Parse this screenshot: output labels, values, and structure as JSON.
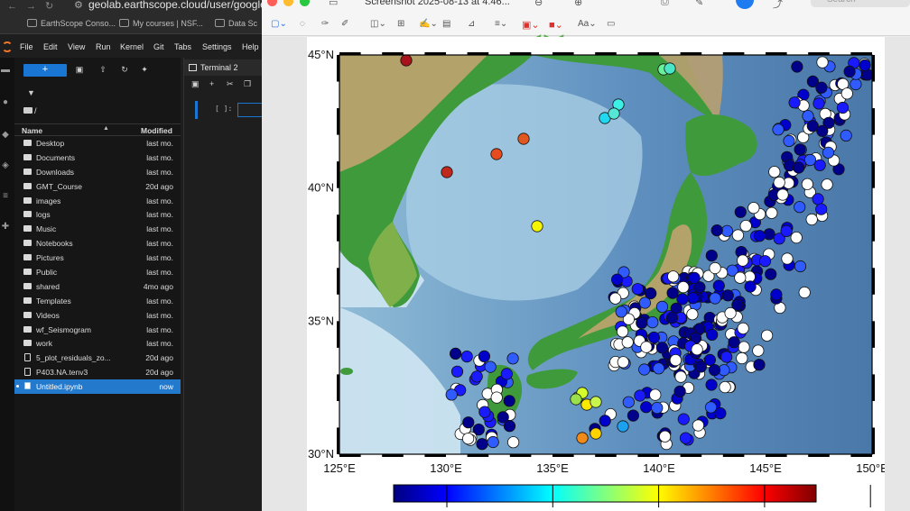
{
  "browser": {
    "url": "geolab.earthscope.cloud/user/google-oauth",
    "bookmarks": [
      "EarthScope Conso...",
      "My courses | NSF...",
      "Data Sc"
    ]
  },
  "jupyter": {
    "menu": [
      "File",
      "Edit",
      "View",
      "Run",
      "Kernel",
      "Git",
      "Tabs",
      "Settings",
      "Help"
    ],
    "new_label": "+",
    "breadcrumb": "/",
    "columns": {
      "name": "Name",
      "modified": "Modified"
    },
    "files": [
      {
        "name": "Desktop",
        "modified": "last mo.",
        "type": "folder"
      },
      {
        "name": "Documents",
        "modified": "last mo.",
        "type": "folder"
      },
      {
        "name": "Downloads",
        "modified": "last mo.",
        "type": "folder"
      },
      {
        "name": "GMT_Course",
        "modified": "20d ago",
        "type": "folder"
      },
      {
        "name": "images",
        "modified": "last mo.",
        "type": "folder"
      },
      {
        "name": "logs",
        "modified": "last mo.",
        "type": "folder"
      },
      {
        "name": "Music",
        "modified": "last mo.",
        "type": "folder"
      },
      {
        "name": "Notebooks",
        "modified": "last mo.",
        "type": "folder"
      },
      {
        "name": "Pictures",
        "modified": "last mo.",
        "type": "folder"
      },
      {
        "name": "Public",
        "modified": "last mo.",
        "type": "folder"
      },
      {
        "name": "shared",
        "modified": "4mo ago",
        "type": "folder"
      },
      {
        "name": "Templates",
        "modified": "last mo.",
        "type": "folder"
      },
      {
        "name": "Videos",
        "modified": "last mo.",
        "type": "folder"
      },
      {
        "name": "wf_Seismogram",
        "modified": "last mo.",
        "type": "folder"
      },
      {
        "name": "work",
        "modified": "last mo.",
        "type": "folder"
      },
      {
        "name": "5_plot_residuals_zo...",
        "modified": "20d ago",
        "type": "file"
      },
      {
        "name": "P403.NA.tenv3",
        "modified": "20d ago",
        "type": "file"
      },
      {
        "name": "Untitled.ipynb",
        "modified": "now",
        "type": "notebook",
        "selected": true
      }
    ],
    "tab_title": "Terminal 2",
    "cell_prompt": "[ ]:"
  },
  "preview": {
    "window_title": "Screenshot 2025-08-13 at 4.46...",
    "search_placeholder": "Search"
  },
  "map": {
    "lat_labels": [
      "45°N",
      "40°N",
      "35°N",
      "30°N"
    ],
    "lon_labels": [
      "125°E",
      "130°E",
      "135°E",
      "140°E",
      "145°E",
      "150°E"
    ],
    "colors": {
      "ocean_deep": "#4a78a8",
      "ocean_shelf": "#cfe6f2",
      "land_low": "#3f9a3c",
      "land_high": "#c8a572",
      "cpt": [
        "#000080",
        "#0000ff",
        "#0080ff",
        "#00ffff",
        "#80ff80",
        "#ffff00",
        "#ff8000",
        "#ff0000",
        "#800000"
      ]
    }
  }
}
